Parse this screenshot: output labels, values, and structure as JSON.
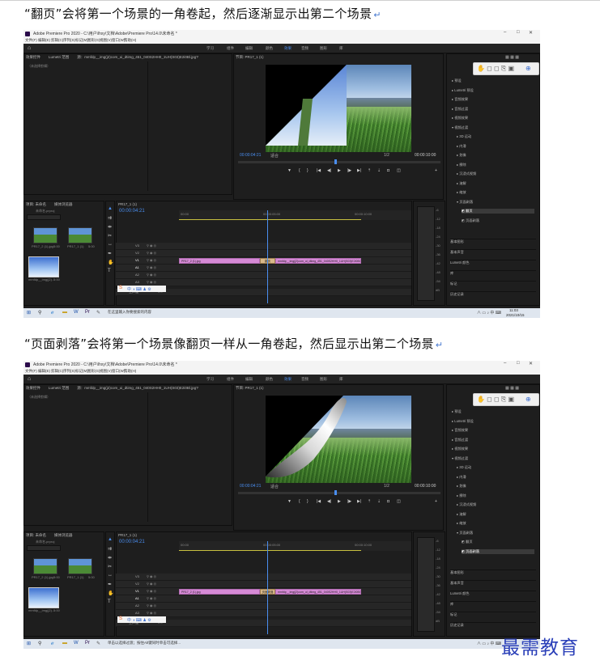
{
  "captions": {
    "first": "“翻页”会将第一个场景的一角卷起，然后逐渐显示出第二个场景",
    "second": "“页面剥落”会将第一个场景像翻页一样从一角卷起，然后显示出第二个场景",
    "para_mark": "↵"
  },
  "shots": [
    {
      "window_title": "Adobe Premiere Pro 2020 - C:\\用户\\lhxy\\文档\\Adobe\\Premiere Pro\\14.0\\未命名 *",
      "menu": [
        "文件(F)",
        "编辑(E)",
        "剪辑(C)",
        "序列(S)",
        "标记(M)",
        "图形(G)",
        "视图(V)",
        "窗口(W)",
        "帮助(H)"
      ],
      "workspaces": [
        "学习",
        "组件",
        "编辑",
        "颜色",
        "效果",
        "音频",
        "图形",
        "库"
      ],
      "active_workspace": "效果",
      "source_tabs": [
        "效果控件",
        "Lumetri 范围",
        "源：mmfdp__img(j2)com_ui_dtimg_451_040S2HH0_1UH(S03)E2i0Bl.jpg?width=ffdp__.jnt"
      ],
      "no_clip": "（未选择剪辑）",
      "program_tab": "节目: PR17_1 (1)",
      "program_tc": "00:00:04:21",
      "program_fit": "适合",
      "program_ratio": "1/2",
      "program_dur": "00:00:10:00",
      "project_tabs": [
        "项目: 未命名",
        "媒体浏览器"
      ],
      "project_name": "未命名.prproj",
      "bins": [
        "PR17_2 (1).jpg",
        "PR17_1 (1)",
        "mmfdp__img(j2)..."
      ],
      "bin_durations": [
        "5:00",
        "5:00",
        "5:00"
      ],
      "seq_tab": "PR17_1 (1)",
      "seq_tc": "00:00:04:21",
      "ruler": [
        "00:00",
        "00:00:05:00",
        "00:00:10:00"
      ],
      "track_names": [
        "V3",
        "V2",
        "V1",
        "A1",
        "A2",
        "A3",
        "主声道"
      ],
      "master_val": "0.0",
      "clip_a": "PR17_2 (1).jpg",
      "transition": "翻页",
      "clip_b": "mmfdp__img(j2)com_ui_dtimg_451_040S2HH0_1UH(S03)E2i0Bl",
      "effects_tree": [
        "预设",
        "Lumetri 预设",
        "音频效果",
        "音频过渡",
        "视频效果",
        "视频过渡",
        "3D 运动",
        "内滑",
        "划像",
        "擦除",
        "沉浸式视频",
        "溶解",
        "缩放",
        "页面剥落",
        "翻页",
        "页面剥落"
      ],
      "effects_side": [
        "基本图形",
        "基本声音",
        "Lumetri 颜色",
        "库",
        "标记",
        "历史记录"
      ],
      "meter_labels": [
        "-6",
        "-12",
        "-18",
        "-24",
        "-30",
        "-36",
        "-42",
        "-48",
        "-54",
        "dB"
      ],
      "taskbar_search": "在这里输入你要搜索的内容",
      "clock_time": "11:03",
      "clock_date": "2021/10/15"
    },
    {
      "window_title": "Adobe Premiere Pro 2020 - C:\\用户\\lhxy\\文档\\Adobe\\Premiere Pro\\14.0\\未命名 *",
      "menu": [
        "文件(F)",
        "编辑(E)",
        "剪辑(C)",
        "序列(S)",
        "标记(M)",
        "图形(G)",
        "视图(V)",
        "窗口(W)",
        "帮助(H)"
      ],
      "workspaces": [
        "学习",
        "组件",
        "编辑",
        "颜色",
        "效果",
        "音频",
        "图形",
        "库"
      ],
      "active_workspace": "效果",
      "source_tabs": [
        "效果控件",
        "Lumetri 范围",
        "源：mmfdp__img(j2)com_ui_dtimg_451_040S2HH0_1UH(S03)E2i0Bl.jpg?width=ffdp__.jnt"
      ],
      "no_clip": "（未选择剪辑）",
      "program_tab": "节目: PR17_1 (1)",
      "program_tc": "00:00:04:21",
      "program_fit": "适合",
      "program_ratio": "1/2",
      "program_dur": "00:00:10:00",
      "project_tabs": [
        "项目: 未命名",
        "媒体浏览器"
      ],
      "project_name": "未命名.prproj",
      "bins": [
        "PR17_2 (1).jpg",
        "PR17_1 (1)",
        "mmfdp__img(j2)..."
      ],
      "bin_durations": [
        "5:00",
        "5:00",
        "5:00"
      ],
      "seq_tab": "PR17_1 (1)",
      "seq_tc": "00:00:04:21",
      "ruler": [
        "00:00",
        "00:00:05:00",
        "00:00:10:00"
      ],
      "track_names": [
        "V3",
        "V2",
        "V1",
        "A1",
        "A2",
        "A3",
        "主声道"
      ],
      "master_val": "0.0",
      "clip_a": "PR17_2 (1).jpg",
      "transition": "页面剥落",
      "clip_b": "mmfdp__img(j2)com_ui_dtimg_451_040S2HH0_1UH(S03)E2i0Bl",
      "effects_tree": [
        "预设",
        "Lumetri 预设",
        "音频效果",
        "音频过渡",
        "视频效果",
        "视频过渡",
        "3D 运动",
        "内滑",
        "划像",
        "擦除",
        "沉浸式视频",
        "溶解",
        "缩放",
        "页面剥落",
        "翻页",
        "页面剥落"
      ],
      "effects_side": [
        "基本图形",
        "基本声音",
        "Lumetri 颜色",
        "库",
        "标记",
        "历史记录"
      ],
      "meter_labels": [
        "-6",
        "-12",
        "-18",
        "-24",
        "-30",
        "-36",
        "-42",
        "-48",
        "-54",
        "dB"
      ],
      "taskbar_search": "单击以选择过渡；按住Alt键同时单击可选择...",
      "clock_time": "",
      "clock_date": ""
    }
  ],
  "watermark": "最需教育"
}
